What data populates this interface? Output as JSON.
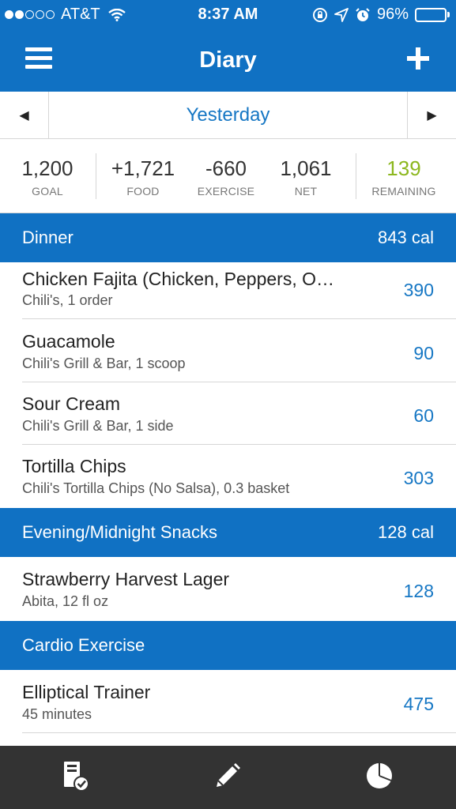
{
  "status_bar": {
    "carrier": "AT&T",
    "signal_filled": 2,
    "signal_empty": 3,
    "time": "8:37 AM",
    "battery": "96%",
    "battery_level": 0.96
  },
  "nav": {
    "title": "Diary",
    "menu_icon": "hamburger-menu-icon",
    "add_icon": "plus-icon"
  },
  "date_nav": {
    "label": "Yesterday",
    "prev": "◀",
    "next": "▶"
  },
  "summary": {
    "goal": {
      "value": "1,200",
      "label": "GOAL"
    },
    "food": {
      "value": "+1,721",
      "label": "FOOD"
    },
    "exercise": {
      "value": "-660",
      "label": "EXERCISE"
    },
    "net": {
      "value": "1,061",
      "label": "NET"
    },
    "remaining": {
      "value": "139",
      "label": "REMAINING"
    }
  },
  "sections": [
    {
      "title": "Dinner",
      "calories": "843 cal",
      "items": [
        {
          "name": "Chicken Fajita (Chicken, Peppers, O…",
          "detail": "Chili's, 1 order",
          "calories": "390"
        },
        {
          "name": "Guacamole",
          "detail": "Chili's Grill & Bar, 1 scoop",
          "calories": "90"
        },
        {
          "name": "Sour Cream",
          "detail": "Chili's Grill & Bar, 1 side",
          "calories": "60"
        },
        {
          "name": "Tortilla Chips",
          "detail": "Chili's Tortilla Chips (No Salsa), 0.3 basket",
          "calories": "303"
        }
      ]
    },
    {
      "title": "Evening/Midnight Snacks",
      "calories": "128 cal",
      "items": [
        {
          "name": "Strawberry Harvest Lager",
          "detail": "Abita, 12 fl oz",
          "calories": "128"
        }
      ]
    },
    {
      "title": "Cardio Exercise",
      "calories": "",
      "items": [
        {
          "name": "Elliptical Trainer",
          "detail": "45 minutes",
          "calories": "475"
        }
      ]
    }
  ],
  "tab_bar": {
    "tabs": [
      {
        "icon": "diary-checklist-icon"
      },
      {
        "icon": "pencil-icon"
      },
      {
        "icon": "pie-chart-icon"
      }
    ]
  },
  "colors": {
    "brand_blue": "#1071c3",
    "link_blue": "#1677c4",
    "remaining_green": "#8cb71e",
    "tab_bar_bg": "#333333"
  }
}
